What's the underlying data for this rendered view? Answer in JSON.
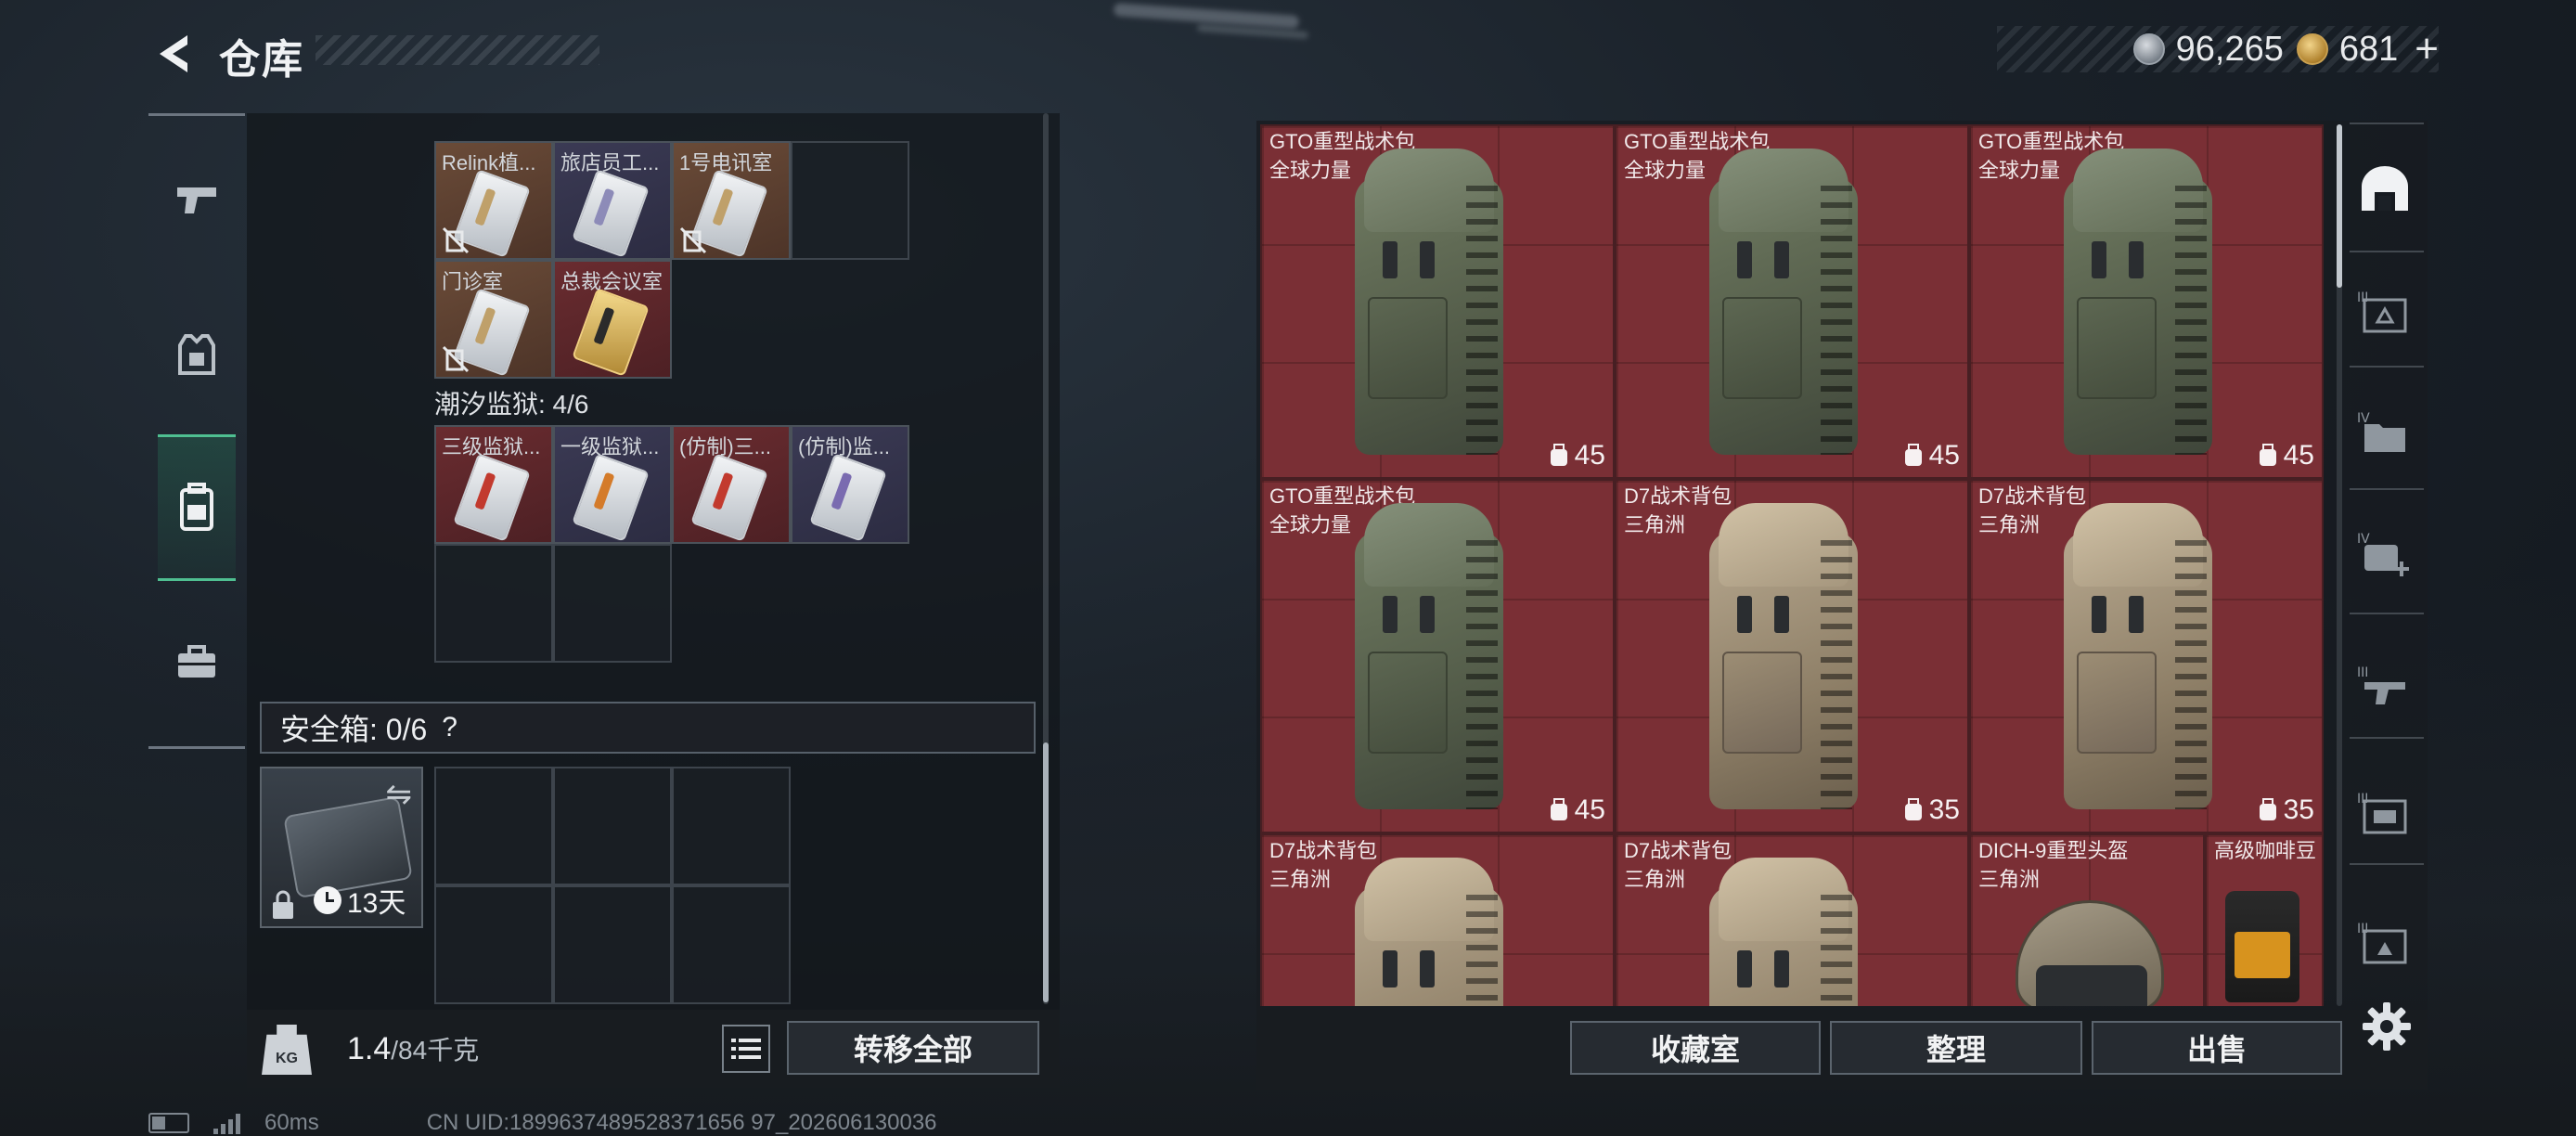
{
  "header": {
    "title": "仓库",
    "currency": {
      "silver_amount": "96,265",
      "gold_amount": "681",
      "gold_plus": "+"
    }
  },
  "left_rail": {
    "items": [
      {
        "name": "weapons",
        "icon": "pistol-icon"
      },
      {
        "name": "armor",
        "icon": "vest-icon"
      },
      {
        "name": "backpack",
        "icon": "backpack-icon",
        "active": true
      },
      {
        "name": "tools",
        "icon": "toolbox-icon"
      }
    ]
  },
  "keys_section_1": {
    "items": [
      {
        "label": "Relink植...",
        "color": "orange",
        "locked": true
      },
      {
        "label": "旅店员工...",
        "color": "purple",
        "locked": false
      },
      {
        "label": "1号电讯室",
        "color": "orange",
        "locked": true
      },
      {
        "label": "门诊室",
        "color": "orange",
        "locked": true
      },
      {
        "label": "总裁会议室",
        "color": "red",
        "locked": false
      }
    ]
  },
  "keys_section_2": {
    "title": "潮汐监狱: 4/6",
    "items": [
      {
        "label": "三级监狱...",
        "color": "red"
      },
      {
        "label": "一级监狱...",
        "color": "purple"
      },
      {
        "label": "(仿制)三...",
        "color": "red"
      },
      {
        "label": "(仿制)监...",
        "color": "purple"
      }
    ]
  },
  "safe_box": {
    "label": "安全箱: 0/6",
    "help": "?",
    "case_timer": "13天"
  },
  "bottom_left": {
    "weight_icon_text": "KG",
    "weight_current": "1.4",
    "weight_capacity": "/84千克",
    "transfer_all": "转移全部"
  },
  "inventory": {
    "items": [
      {
        "name": "GTO重型战术包",
        "sub": "全球力量",
        "capacity": "45",
        "style": "green"
      },
      {
        "name": "GTO重型战术包",
        "sub": "全球力量",
        "capacity": "45",
        "style": "green"
      },
      {
        "name": "GTO重型战术包",
        "sub": "全球力量",
        "capacity": "45",
        "style": "green"
      },
      {
        "name": "GTO重型战术包",
        "sub": "全球力量",
        "capacity": "45",
        "style": "green"
      },
      {
        "name": "D7战术背包",
        "sub": "三角洲",
        "capacity": "35",
        "style": "tan"
      },
      {
        "name": "D7战术背包",
        "sub": "三角洲",
        "capacity": "35",
        "style": "tan"
      },
      {
        "name": "D7战术背包",
        "sub": "三角洲",
        "capacity": "",
        "style": "tan"
      },
      {
        "name": "D7战术背包",
        "sub": "三角洲",
        "capacity": "",
        "style": "tan"
      },
      {
        "name": "DICH-9重型头盔",
        "sub": "三角洲",
        "capacity": "",
        "style": "helmet"
      },
      {
        "name": "高级咖啡豆",
        "sub": "",
        "capacity": "",
        "style": "coffee"
      }
    ]
  },
  "bottom_right": {
    "collection_room": "收藏室",
    "organize": "整理",
    "sell": "出售"
  },
  "right_rail": {
    "items": [
      "III",
      "IV",
      "IV",
      "III",
      "III",
      "III"
    ]
  },
  "status": {
    "ping": "60ms",
    "uid": "CN UID:1899637489528371656 97_202606130036"
  },
  "colors": {
    "accent_green": "#4fbf91",
    "inventory_bg": "#7a2f35"
  }
}
